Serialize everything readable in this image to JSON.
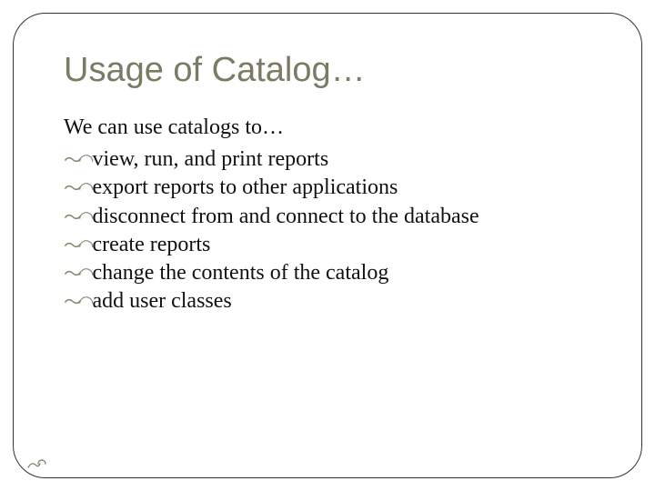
{
  "title": "Usage of Catalog…",
  "intro": "We can use catalogs to…",
  "bullets": [
    "view, run, and print reports",
    "export reports to other applications",
    "disconnect from and connect to the database",
    "create reports",
    "change the contents of the catalog",
    "add user classes"
  ],
  "bullet_glyph": "d"
}
